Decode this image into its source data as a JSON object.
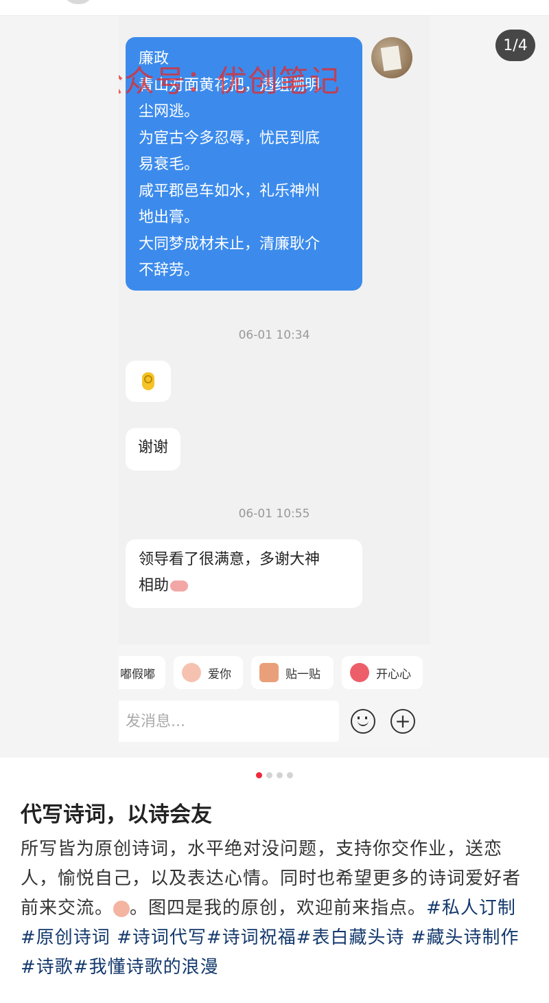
{
  "carousel": {
    "page_indicator": "1/4",
    "page_count": 4,
    "active_page": 1
  },
  "chat": {
    "watermark": "公众号：优创笔记",
    "outgoing_message": "廉政\n青山对面黄花把，透组溯明\n尘网逃。\n为宦古今多忍辱，忧民到底\n易衰毛。\n咸平郡邑车如水，礼乐神州\n地出膏。\n大同梦成材未止，清廉耿介\n不辞劳。",
    "timestamp_1": "06-01 10:34",
    "message_thanks": "谢谢",
    "timestamp_2": "06-01 10:55",
    "message_praise": "领导看了很满意，多谢大神\n相助",
    "quick_replies": [
      "嘟假嘟",
      "爱你",
      "贴一贴",
      "开心心"
    ],
    "input_placeholder": "发消息..."
  },
  "post": {
    "title": "代写诗词，以诗会友",
    "body_text_1": "所写皆为原创诗词，水平绝对没问题，支持你交作业，送恋人，愉悦自己，以及表达心情。同时也希望更多的诗词爱好者前来交流。",
    "body_text_2": "。图四是我的原创，欢迎前来指点。",
    "tags": [
      "#私人订制",
      "#原创诗词",
      "#诗词代写",
      "#诗词祝福",
      "#表白藏头诗",
      "#藏头诗制作",
      "#诗歌",
      "#我懂诗歌的浪漫"
    ]
  },
  "colors": {
    "bubble_outgoing": "#3c8bec",
    "watermark": "#e62828",
    "tag": "#13386c",
    "dot_active": "#ee2a3c"
  }
}
